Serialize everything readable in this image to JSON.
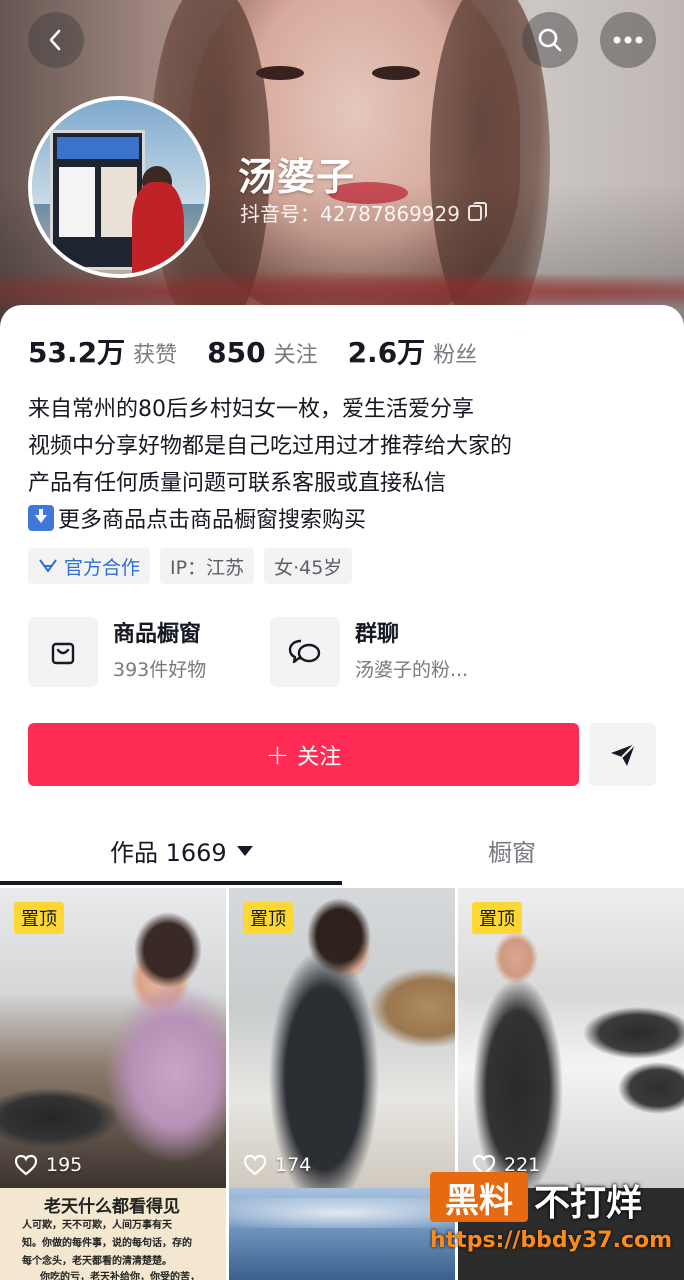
{
  "profile": {
    "name": "汤婆子",
    "douyin_id": "抖音号：42787869929"
  },
  "stats": [
    {
      "num": "53.2万",
      "label": "获赞"
    },
    {
      "num": "850",
      "label": "关注"
    },
    {
      "num": "2.6万",
      "label": "粉丝"
    }
  ],
  "bio": [
    "来自常州的80后乡村妇女一枚，爱生活爱分享",
    "视频中分享好物都是自己吃过用过才推荐给大家的",
    "产品有任何质量问题可联系客服或直接私信",
    "更多商品点击商品橱窗搜索购买"
  ],
  "tags": {
    "official": "官方合作",
    "ip": "IP：江苏",
    "gender_age": "女·45岁"
  },
  "shortcuts": [
    {
      "title": "商品橱窗",
      "sub": "393件好物",
      "icon": "shopping-bag-icon"
    },
    {
      "title": "群聊",
      "sub": "汤婆子的粉...",
      "icon": "chat-bubbles-icon"
    }
  ],
  "actions": {
    "follow": "关注",
    "follow_plus": "+"
  },
  "tabs": {
    "works": "作品 1669",
    "showcase": "橱窗"
  },
  "videos": [
    {
      "pinned": "置顶",
      "likes": "195"
    },
    {
      "pinned": "置顶",
      "likes": "174"
    },
    {
      "pinned": "置顶",
      "likes": "221"
    }
  ],
  "second_row": {
    "title": "老天什么都看得见",
    "lines": [
      "人可欺，天不可欺，人间万事有天",
      "知。你做的每件事，说的每句话，存的",
      "每个念头，老天都看的清清楚楚。",
      "你吃的亏，老天补给你，你受的苦，"
    ]
  },
  "watermark": {
    "badge": "黑料",
    "text": "不打烊",
    "url": "https://bbdy37.com"
  },
  "colors": {
    "accent": "#fe2c55",
    "pin": "#fdd835",
    "link": "#2f6fd6"
  }
}
